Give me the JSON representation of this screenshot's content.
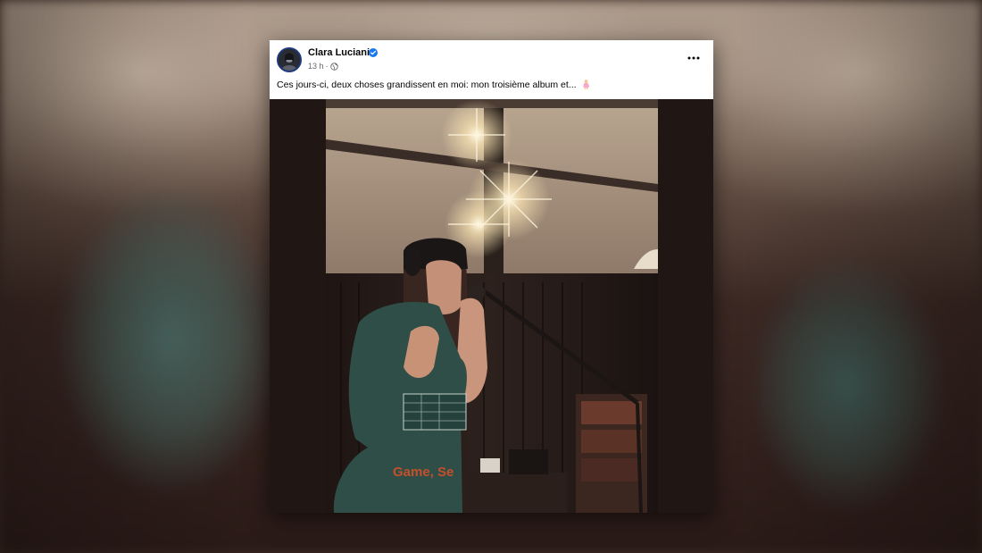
{
  "post": {
    "author": "Clara Luciani",
    "time": "13 h",
    "separator": "·",
    "caption": "Ces jours-ci, deux choses grandissent en moi: mon troisième album et...",
    "verified_icon": "verified-badge-icon",
    "audience_icon": "globe-icon",
    "menu_icon": "more-options-icon",
    "caption_emoji": "pregnant-woman-emoji",
    "photo_shirt_text": "Game, Se"
  },
  "colors": {
    "facebook_blue": "#1877f2",
    "card_bg": "#ffffff",
    "secondary_text": "#65676b",
    "shirt_green": "#2f4e47",
    "shirt_print_orange": "#c4502b"
  }
}
